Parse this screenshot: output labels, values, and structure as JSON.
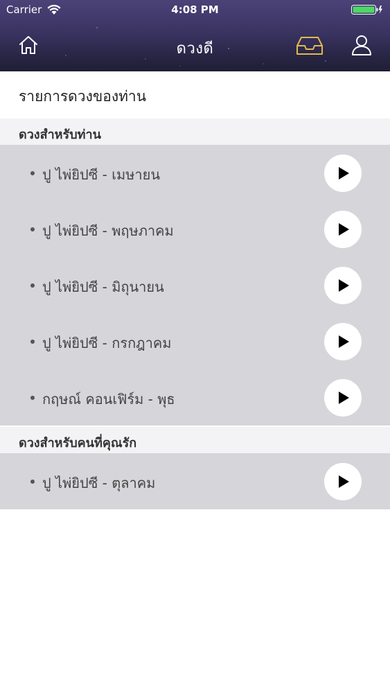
{
  "status_bar": {
    "carrier": "Carrier",
    "time": "4:08 PM",
    "battery_color": "#4cd964"
  },
  "nav": {
    "title": "ดวงดี",
    "inbox_icon_color": "#e2b84f",
    "icons": [
      "home-icon",
      "inbox-icon",
      "user-icon"
    ]
  },
  "page": {
    "heading": "รายการดวงของท่าน"
  },
  "sections": [
    {
      "title": "ดวงสำหรับท่าน",
      "items": [
        {
          "label": "ปู ไพ่ยิปซี - เมษายน"
        },
        {
          "label": "ปู ไพ่ยิปซี - พฤษภาคม"
        },
        {
          "label": "ปู ไพ่ยิปซี - มิถุนายน"
        },
        {
          "label": "ปู ไพ่ยิปซี - กรกฎาคม"
        },
        {
          "label": "กฤษณ์ คอนเฟิร์ม - พุธ"
        }
      ]
    },
    {
      "title": "ดวงสำหรับคนที่คุณรัก",
      "items": [
        {
          "label": "ปู ไพ่ยิปซี - ตุลาคม"
        }
      ]
    }
  ],
  "colors": {
    "header_top": "#4b4277",
    "header_bottom": "#1f1e34",
    "list_background": "#d6d5da",
    "section_header_background": "#f3f3f5"
  }
}
